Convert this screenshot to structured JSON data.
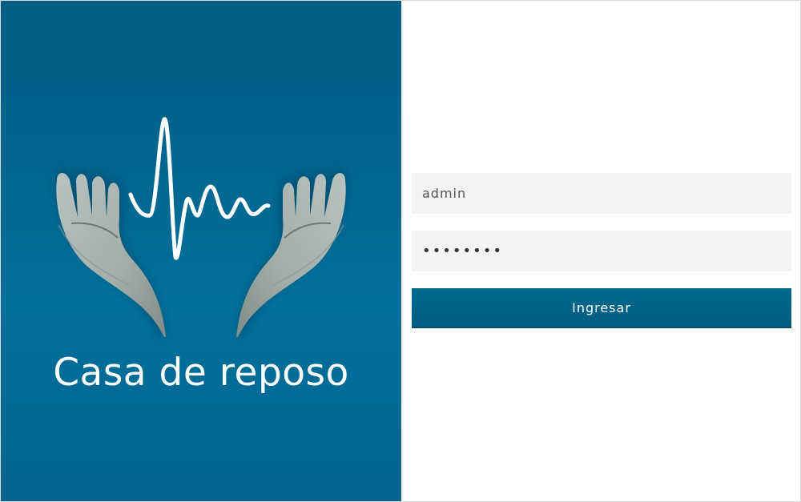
{
  "brand": {
    "name": "Casa de reposo",
    "logo_icon": "hands-heartbeat-icon",
    "panel_color": "#00688f"
  },
  "login": {
    "username_value": "admin",
    "password_value": "••••••••",
    "submit_label": "Ingresar",
    "button_color": "#00638a",
    "input_background": "#f3f3f3"
  }
}
